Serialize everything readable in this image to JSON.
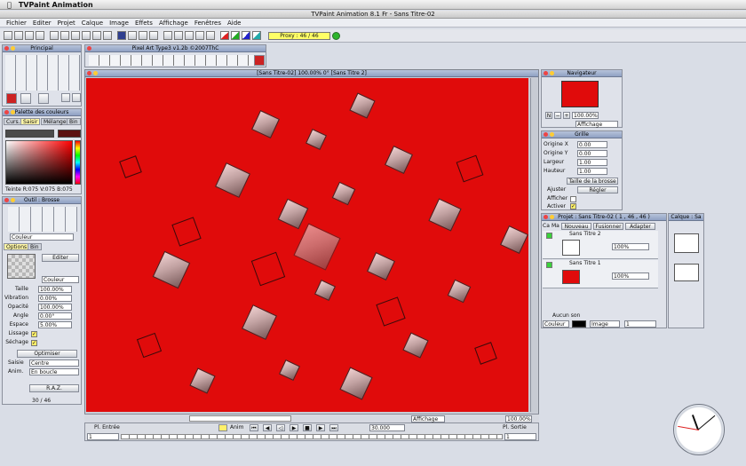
{
  "os_menu": {
    "app": "TVPaint Animation"
  },
  "window": {
    "title": "TVPaint Animation 8.1 Fr - Sans Titre-02"
  },
  "app_menu": [
    "Fichier",
    "Editer",
    "Projet",
    "Calque",
    "Image",
    "Effets",
    "Affichage",
    "Fenêtres",
    "Aide"
  ],
  "toolbar": {
    "proxy_label": "Proxy : 46 / 46"
  },
  "panels": {
    "principal": {
      "title": "Principal"
    },
    "plugin": {
      "title": "Pixel Art Type3 v1.2b ©2007ThC"
    },
    "palette": {
      "title": "Palette des couleurs",
      "tabs": [
        "Curs.",
        "Saisir",
        "Mélange",
        "Bin"
      ],
      "readout": "Teinte R:075 V:075 B:075"
    },
    "brush": {
      "title": "Outil : Brosse",
      "color_select": "Couleur",
      "tabs": [
        "Options",
        "Bin"
      ],
      "edit_btn": "Editer",
      "mode_select": "Couleur",
      "rows": [
        {
          "label": "Taille",
          "value": "100.00%"
        },
        {
          "label": "Vibration",
          "value": "0.00%"
        },
        {
          "label": "Opacité",
          "value": "100.00%"
        },
        {
          "label": "Angle",
          "value": "0.00°"
        },
        {
          "label": "Espace",
          "value": "5.00%"
        }
      ],
      "lissage": "Lissage",
      "sechage": "Séchage",
      "optimize_btn": "Optimiser",
      "saisie_label": "Saisie",
      "saisie_value": "Centre",
      "anim_label": "Anim.",
      "anim_value": "En boucle",
      "raz_btn": "R.A.Z.",
      "frame_counter": "30 / 46"
    },
    "canvas": {
      "title": "[Sans Titre-02]   100.00%   0°   [Sans Titre 2]"
    },
    "navigator": {
      "title": "Navigateur",
      "zoom": "100.00%",
      "display_select": "Affichage"
    },
    "grid": {
      "title": "Grille",
      "rows": [
        {
          "label": "Origine X",
          "value": "0.00"
        },
        {
          "label": "Origine Y",
          "value": "0.00"
        },
        {
          "label": "Largeur",
          "value": "1.00"
        },
        {
          "label": "Hauteur",
          "value": "1.00"
        }
      ],
      "brush_size_btn": "Taille de la brosse",
      "adjust_label": "Ajuster",
      "adjust_btn": "Régler",
      "show_label": "Afficher",
      "activate_label": "Activer"
    },
    "project": {
      "title": "Projet : Sans Titre-02 ( 1 , 46 , 46 )",
      "header": [
        "Ca",
        "Ma",
        "Nouveau",
        "Fusionner",
        "Adapter"
      ],
      "layers": [
        {
          "name": "Sans Titre 2",
          "opacity": "100%"
        },
        {
          "name": "Sans Titre 1",
          "opacity": "100%"
        }
      ],
      "no_sound": "Aucun son",
      "color_select": "Couleur",
      "image_select": "Image",
      "image_value": "1"
    },
    "calque": {
      "title": "Calque : Sa"
    }
  },
  "status": {
    "display_select": "Affichage",
    "zoom": "100.00%"
  },
  "timeline": {
    "start_label": "Pl. Entrée",
    "end_label": "Pl. Sortie",
    "anim_label": "Anim",
    "fps": "30.000",
    "frame_in": "1",
    "frame_out": "1"
  },
  "colors": {
    "canvas_bg": "#e00b0b",
    "title_blue": "#8fa1c3",
    "proxy_yellow": "#ffff66"
  }
}
